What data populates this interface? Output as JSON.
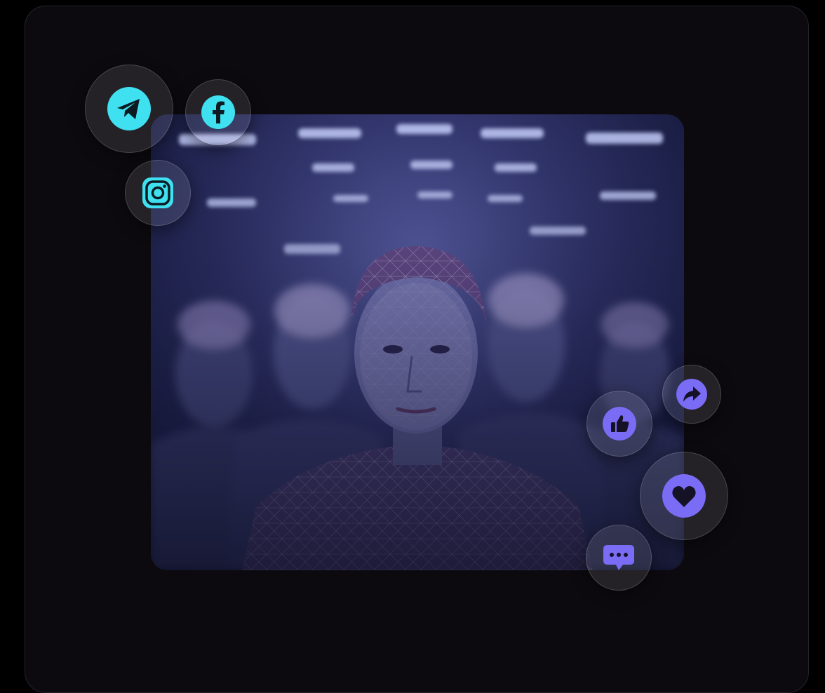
{
  "hero": {
    "subject": "ai-face-mesh-crowd"
  },
  "colors": {
    "card_bg": "#0c0a0e",
    "social_accent": "#3fe0f0",
    "reaction_accent": "#7b6cf6",
    "hero_tint": "#4a4f95"
  },
  "social_icons": [
    {
      "name": "telegram-icon"
    },
    {
      "name": "facebook-icon"
    },
    {
      "name": "instagram-icon"
    }
  ],
  "reaction_icons": [
    {
      "name": "share-icon"
    },
    {
      "name": "like-icon"
    },
    {
      "name": "heart-icon"
    },
    {
      "name": "comment-icon"
    }
  ]
}
